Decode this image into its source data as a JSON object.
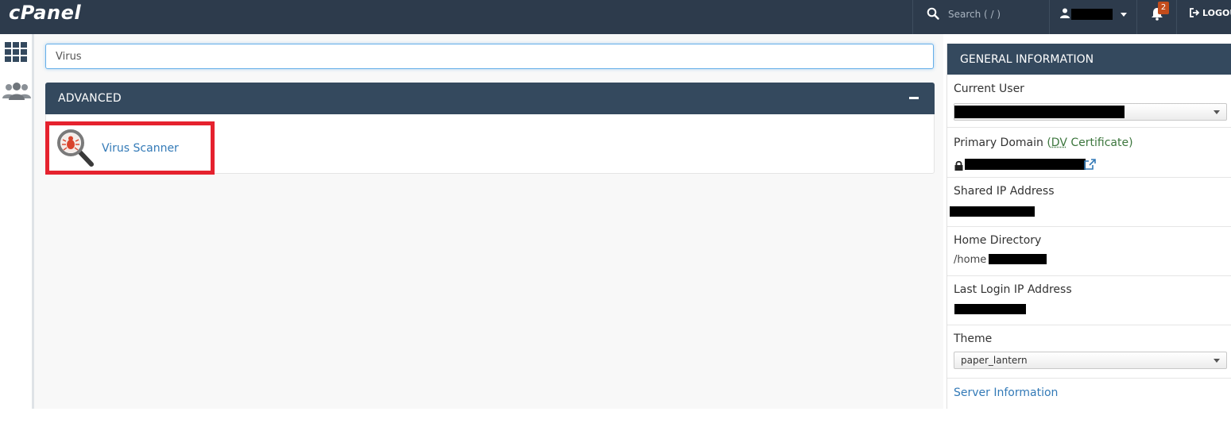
{
  "topbar": {
    "logo": "cPanel",
    "search_placeholder": "Search ( / )",
    "notifications_count": "2",
    "logout_label": "LOGOUT"
  },
  "sidebar": {
    "items": [
      {
        "icon": "grid-icon"
      },
      {
        "icon": "users-icon"
      }
    ]
  },
  "main": {
    "quickfind_value": "Virus",
    "group": {
      "title": "ADVANCED",
      "items": [
        {
          "label": "Virus Scanner",
          "icon": "virus-scanner-icon"
        }
      ]
    }
  },
  "general_information": {
    "title": "GENERAL INFORMATION",
    "current_user_label": "Current User",
    "primary_domain_label": "Primary Domain",
    "primary_domain_paren_open": "(",
    "primary_domain_dv": "DV",
    "primary_domain_cert": " Certificate)",
    "shared_ip_label": "Shared IP Address",
    "home_directory_label": "Home Directory",
    "home_directory_prefix": "/home",
    "last_login_label": "Last Login IP Address",
    "theme_label": "Theme",
    "theme_value": "paper_lantern",
    "server_information_link": "Server Information"
  },
  "colors": {
    "topbar_bg": "#2d3b4c",
    "panel_header_bg": "#34495e",
    "link": "#337ab7",
    "highlight_border": "#e5222e",
    "badge": "#c24c1c"
  }
}
